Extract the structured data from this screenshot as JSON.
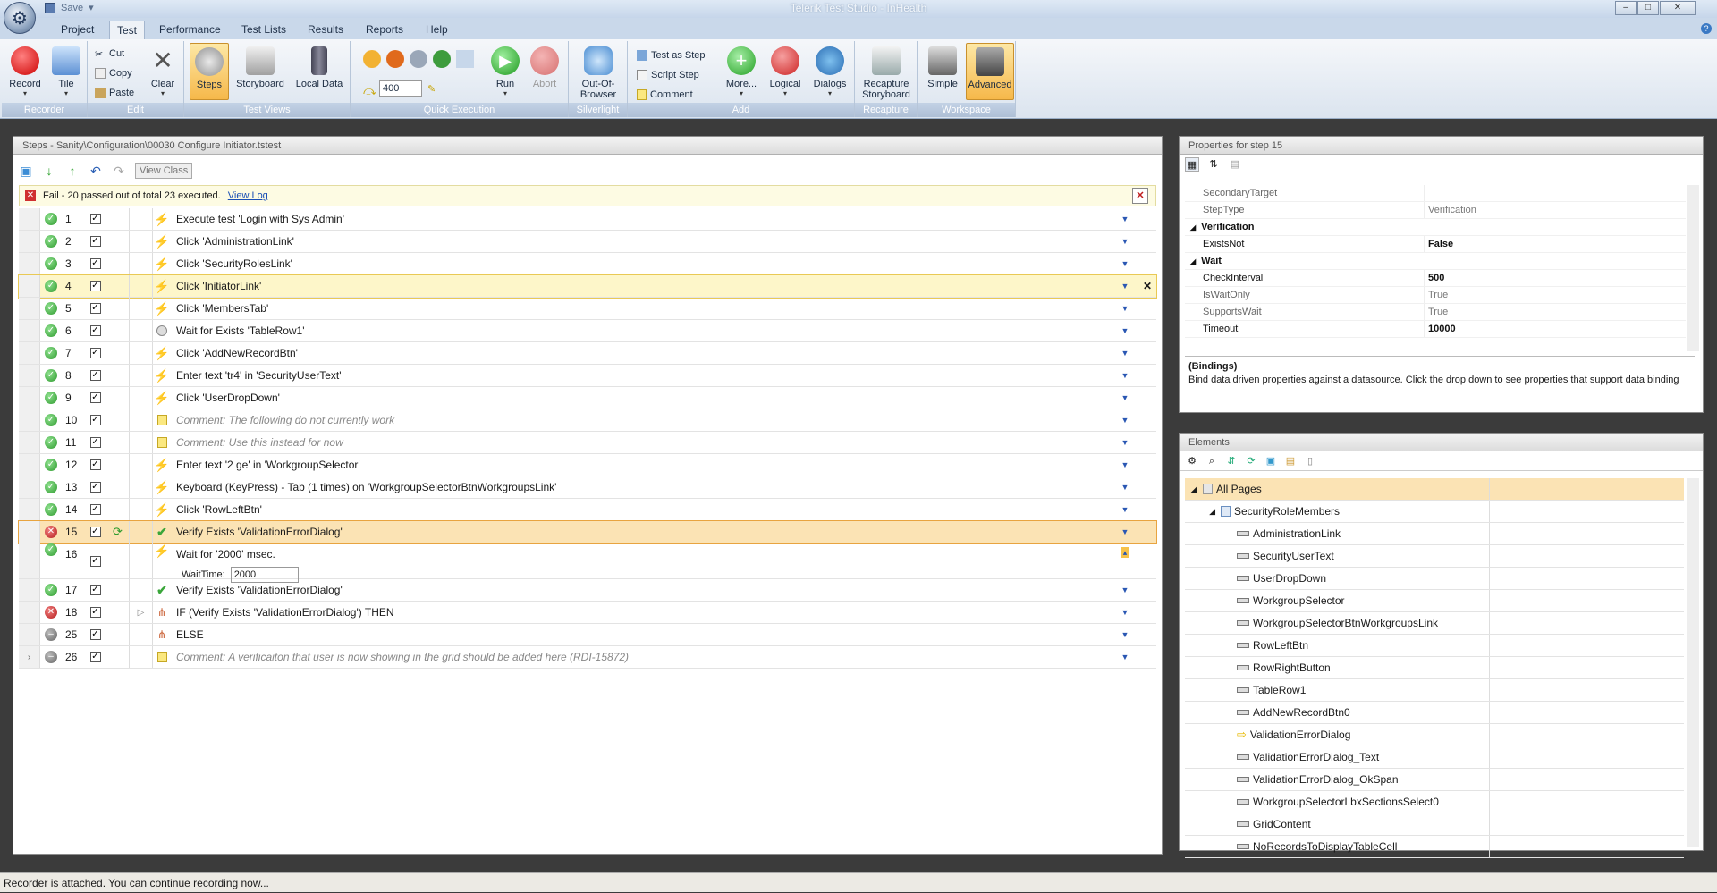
{
  "app": {
    "title": "Telerik Test Studio - InHealth",
    "save_label": "Save"
  },
  "tabs": [
    "Project",
    "Test",
    "Performance",
    "Test Lists",
    "Results",
    "Reports",
    "Help"
  ],
  "ribbon": {
    "groups": {
      "recorder": "Recorder",
      "edit": "Edit",
      "test_views": "Test Views",
      "quick_execution": "Quick Execution",
      "silverlight": "Silverlight",
      "add": "Add",
      "recapture": "Recapture",
      "workspace": "Workspace"
    },
    "buttons": {
      "record": "Record",
      "tile": "Tile",
      "cut": "Cut",
      "copy": "Copy",
      "paste": "Paste",
      "clear": "Clear",
      "steps": "Steps",
      "storyboard": "Storyboard",
      "local_data": "Local Data",
      "speed_value": "400",
      "run": "Run",
      "abort": "Abort",
      "out_of_browser": "Out-Of-Browser",
      "test_as_step": "Test as Step",
      "script_step": "Script Step",
      "comment": "Comment",
      "more": "More...",
      "logical": "Logical",
      "dialogs": "Dialogs",
      "recapture_storyboard": "Recapture Storyboard",
      "simple": "Simple",
      "advanced": "Advanced"
    }
  },
  "steps_panel": {
    "title": "Steps - Sanity\\Configuration\\00030 Configure Initiator.tstest",
    "view_class": "View Class",
    "fail_text": "Fail - 20 passed out of total 23 executed.",
    "view_log": "View Log",
    "rows": [
      {
        "num": "1",
        "status": "pass",
        "icon": "bolt",
        "text": "Execute test 'Login with Sys Admin'"
      },
      {
        "num": "2",
        "status": "pass",
        "icon": "bolt",
        "text": "Click 'AdministrationLink'"
      },
      {
        "num": "3",
        "status": "pass",
        "icon": "bolt",
        "text": "Click 'SecurityRolesLink'"
      },
      {
        "num": "4",
        "status": "pass",
        "icon": "bolt",
        "text": "Click 'InitiatorLink'"
      },
      {
        "num": "5",
        "status": "pass",
        "icon": "bolt",
        "text": "Click 'MembersTab'"
      },
      {
        "num": "6",
        "status": "pass",
        "icon": "clock",
        "text": "Wait for Exists 'TableRow1'"
      },
      {
        "num": "7",
        "status": "pass",
        "icon": "bolt",
        "text": "Click 'AddNewRecordBtn'"
      },
      {
        "num": "8",
        "status": "pass",
        "icon": "bolt",
        "text": "Enter text 'tr4' in 'SecurityUserText'"
      },
      {
        "num": "9",
        "status": "pass",
        "icon": "bolt",
        "text": "Click 'UserDropDown'"
      },
      {
        "num": "10",
        "status": "pass",
        "icon": "note",
        "text": "Comment: The following do not currently work"
      },
      {
        "num": "11",
        "status": "pass",
        "icon": "note",
        "text": "Comment: Use this instead for now"
      },
      {
        "num": "12",
        "status": "pass",
        "icon": "bolt",
        "text": "Enter text '2 ge' in 'WorkgroupSelector'"
      },
      {
        "num": "13",
        "status": "pass",
        "icon": "bolt",
        "text": "Keyboard (KeyPress) - Tab (1 times) on 'WorkgroupSelectorBtnWorkgroupsLink'"
      },
      {
        "num": "14",
        "status": "pass",
        "icon": "bolt",
        "text": "Click 'RowLeftBtn'"
      },
      {
        "num": "15",
        "status": "fail",
        "icon": "check",
        "text": "Verify Exists 'ValidationErrorDialog'"
      },
      {
        "num": "16",
        "status": "pass",
        "icon": "bolt",
        "text": "Wait for '2000' msec."
      },
      {
        "num": "17",
        "status": "pass",
        "icon": "check",
        "text": "Verify Exists 'ValidationErrorDialog'"
      },
      {
        "num": "18",
        "status": "fail",
        "icon": "branch",
        "text": "IF (Verify Exists 'ValidationErrorDialog') THEN"
      },
      {
        "num": "25",
        "status": "none",
        "icon": "branch",
        "text": "ELSE"
      },
      {
        "num": "26",
        "status": "none",
        "icon": "note",
        "text": "Comment: A verificaiton that user is now showing in the grid should be added here (RDI-15872)"
      }
    ],
    "wait_time_label": "WaitTime:",
    "wait_time_value": "2000"
  },
  "properties": {
    "title": "Properties for step 15",
    "rows": [
      {
        "key": "SecondaryTarget",
        "value": "",
        "kind": "normal"
      },
      {
        "key": "StepType",
        "value": "Verification",
        "kind": "normal"
      },
      {
        "key": "Verification",
        "value": "",
        "kind": "cat"
      },
      {
        "key": "ExistsNot",
        "value": "False",
        "kind": "bold"
      },
      {
        "key": "Wait",
        "value": "",
        "kind": "cat"
      },
      {
        "key": "CheckInterval",
        "value": "500",
        "kind": "bold"
      },
      {
        "key": "IsWaitOnly",
        "value": "True",
        "kind": "normal"
      },
      {
        "key": "SupportsWait",
        "value": "True",
        "kind": "normal"
      },
      {
        "key": "Timeout",
        "value": "10000",
        "kind": "bold"
      }
    ],
    "bindings_title": "(Bindings)",
    "bindings_text": "Bind data driven properties against a datasource. Click the drop down to see properties that support data binding"
  },
  "elements": {
    "title": "Elements",
    "root": "All Pages",
    "page": "SecurityRoleMembers",
    "items": [
      "AdministrationLink",
      "SecurityUserText",
      "UserDropDown",
      "WorkgroupSelector",
      "WorkgroupSelectorBtnWorkgroupsLink",
      "RowLeftBtn",
      "RowRightButton",
      "TableRow1",
      "AddNewRecordBtn0",
      "ValidationErrorDialog",
      "ValidationErrorDialog_Text",
      "ValidationErrorDialog_OkSpan",
      "WorkgroupSelectorLbxSectionsSelect0",
      "GridContent",
      "NoRecordsToDisplayTableCell"
    ]
  },
  "status_bar": "Recorder is attached. You can continue recording now..."
}
